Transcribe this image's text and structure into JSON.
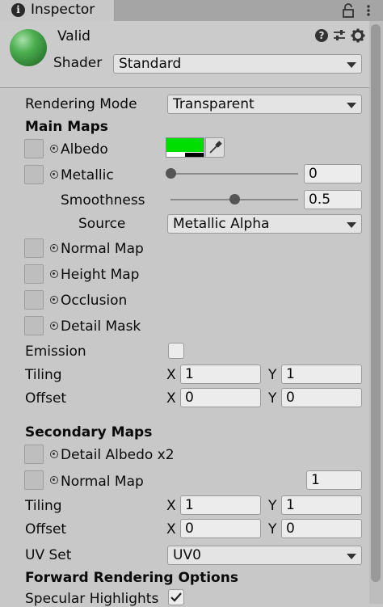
{
  "window": {
    "tab_title": "Inspector",
    "icons": [
      "info-icon",
      "lock-icon",
      "tab-menu-icon"
    ]
  },
  "header": {
    "material_name": "Valid",
    "shader_label": "Shader",
    "shader_value": "Standard",
    "icons": [
      "help-icon",
      "preset-icon",
      "gear-icon"
    ]
  },
  "main": {
    "rendering_mode": {
      "label": "Rendering Mode",
      "value": "Transparent"
    },
    "main_maps": {
      "heading": "Main Maps",
      "albedo": {
        "label": "Albedo",
        "color": "#00dd00"
      },
      "metallic": {
        "label": "Metallic",
        "value": "0",
        "level": 0
      },
      "smoothness": {
        "label": "Smoothness",
        "value": "0.5",
        "level": 0.5
      },
      "source": {
        "label": "Source",
        "value": "Metallic Alpha"
      },
      "normal_map": {
        "label": "Normal Map"
      },
      "height_map": {
        "label": "Height Map"
      },
      "occlusion": {
        "label": "Occlusion"
      },
      "detail_mask": {
        "label": "Detail Mask"
      },
      "emission": {
        "label": "Emission",
        "checked": false
      },
      "tiling": {
        "label": "Tiling",
        "x_label": "X",
        "x": "1",
        "y_label": "Y",
        "y": "1"
      },
      "offset": {
        "label": "Offset",
        "x_label": "X",
        "x": "0",
        "y_label": "Y",
        "y": "0"
      }
    },
    "secondary_maps": {
      "heading": "Secondary Maps",
      "detail_albedo": {
        "label": "Detail Albedo x2"
      },
      "normal_map": {
        "label": "Normal Map",
        "value": "1"
      },
      "tiling": {
        "label": "Tiling",
        "x_label": "X",
        "x": "1",
        "y_label": "Y",
        "y": "1"
      },
      "offset": {
        "label": "Offset",
        "x_label": "X",
        "x": "0",
        "y_label": "Y",
        "y": "0"
      },
      "uv_set": {
        "label": "UV Set",
        "value": "UV0"
      }
    },
    "forward_rendering": {
      "heading": "Forward Rendering Options",
      "specular_highlights": {
        "label": "Specular Highlights",
        "checked": true
      }
    }
  }
}
